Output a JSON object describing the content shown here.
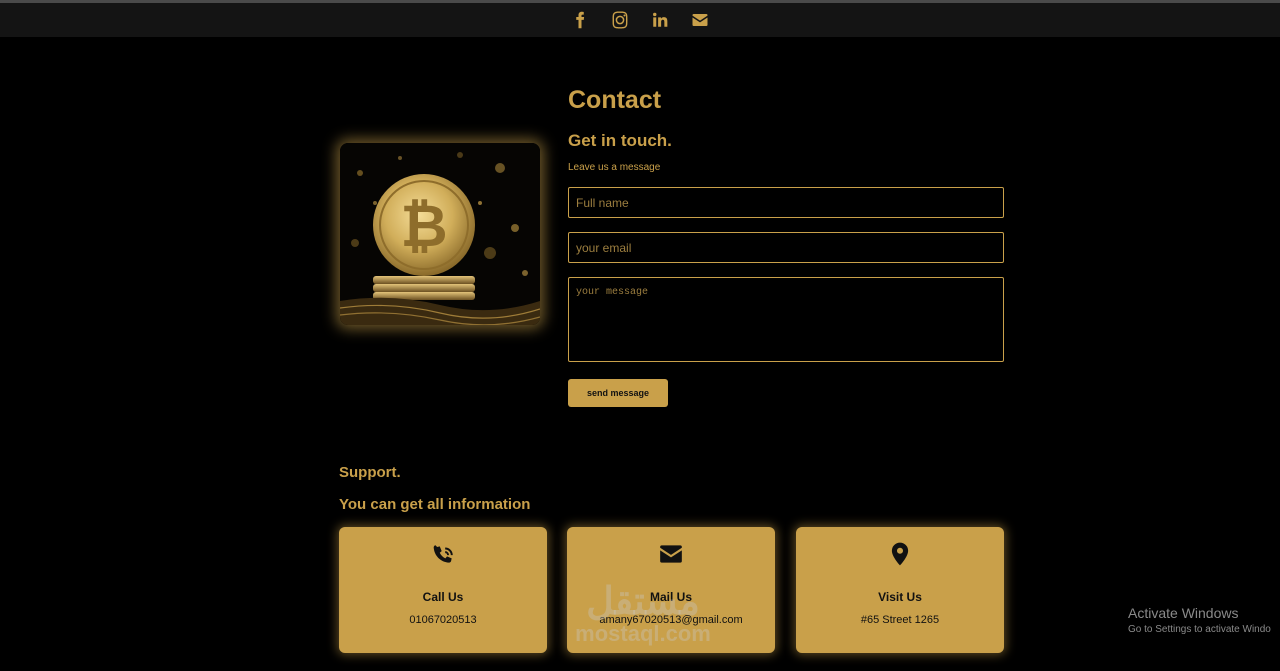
{
  "topbar": {
    "icons": [
      "facebook-icon",
      "instagram-icon",
      "linkedin-icon",
      "envelope-icon"
    ],
    "accent_color": "#c9a04a",
    "background_color": "#141414"
  },
  "contact": {
    "title": "Contact",
    "subtitle": "Get in touch.",
    "lead": "Leave us a message",
    "name_placeholder": "Full name",
    "email_placeholder": "your email",
    "message_placeholder": "your message",
    "send_label": "send message"
  },
  "support": {
    "heading": "Support.",
    "subheading": "You can get all information",
    "cards": [
      {
        "icon": "phone-icon",
        "title": "Call Us",
        "value": "01067020513"
      },
      {
        "icon": "envelope-icon",
        "title": "Mail Us",
        "value": "amany67020513@gmail.com"
      },
      {
        "icon": "map-pin-icon",
        "title": "Visit Us",
        "value": "#65 Street 1265"
      }
    ]
  },
  "watermark": {
    "arabic": "مستقل",
    "latin": "mostaql.com"
  },
  "os_overlay": {
    "line1": "Activate Windows",
    "line2": "Go to Settings to activate Windo"
  }
}
